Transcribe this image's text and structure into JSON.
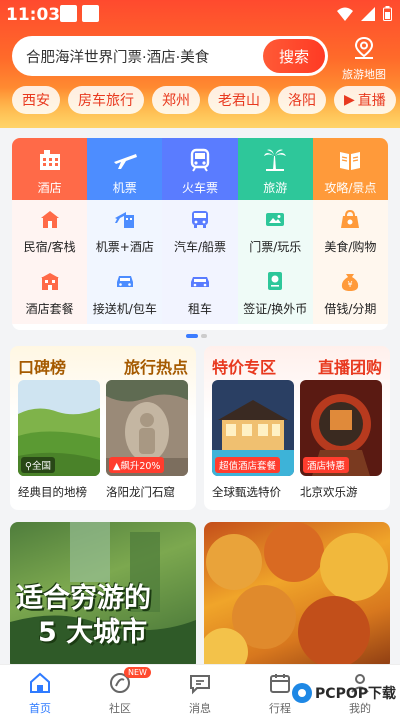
{
  "status_bar": {
    "time": "11:03"
  },
  "search": {
    "placeholder": "合肥海洋世界门票·酒店·美食",
    "button_label": "搜索"
  },
  "map_entry": {
    "label": "旅游地图"
  },
  "chips": [
    "西安",
    "房车旅行",
    "郑州",
    "老君山",
    "洛阳",
    "直播"
  ],
  "main_services": [
    {
      "label": "酒店",
      "icon": "hotel-icon",
      "color": "#ff6a48"
    },
    {
      "label": "机票",
      "icon": "plane-icon",
      "color": "#4d8dff"
    },
    {
      "label": "火车票",
      "icon": "train-icon",
      "color": "#5a7cff"
    },
    {
      "label": "旅游",
      "icon": "palm-icon",
      "color": "#2ec79a"
    },
    {
      "label": "攻略/景点",
      "icon": "book-icon",
      "color": "#ff9a3a"
    }
  ],
  "sub_services": [
    [
      {
        "label": "民宿/客栈",
        "icon": "house-icon"
      },
      {
        "label": "机票+酒店",
        "icon": "plane-hotel-icon"
      },
      {
        "label": "汽车/船票",
        "icon": "bus-icon"
      },
      {
        "label": "门票/玩乐",
        "icon": "ticket-icon"
      },
      {
        "label": "美食/购物",
        "icon": "food-bag-icon"
      }
    ],
    [
      {
        "label": "酒店套餐",
        "icon": "hotel-package-icon"
      },
      {
        "label": "接送机/包车",
        "icon": "car-icon"
      },
      {
        "label": "租车",
        "icon": "rental-car-icon"
      },
      {
        "label": "签证/换外币",
        "icon": "visa-icon"
      },
      {
        "label": "借钱/分期",
        "icon": "money-bag-icon"
      }
    ]
  ],
  "promo_left": {
    "title_a": "口碑榜",
    "title_b": "旅行热点",
    "items": [
      {
        "tag": "全国",
        "caption": "经典目的地榜"
      },
      {
        "tag": "飙升20%",
        "caption": "洛阳龙门石窟"
      }
    ]
  },
  "promo_right": {
    "title_a": "特价专区",
    "title_b": "直播团购",
    "items": [
      {
        "tag": "超值酒店套餐",
        "caption": "全球甄选特价"
      },
      {
        "tag": "酒店特惠",
        "caption": "北京欢乐游"
      }
    ]
  },
  "feed": {
    "left_title_line1": "适合穷游的",
    "left_title_line2": "5 大城市"
  },
  "tabs": [
    {
      "label": "首页",
      "icon": "home-icon"
    },
    {
      "label": "社区",
      "icon": "community-icon",
      "badge": "NEW"
    },
    {
      "label": "消息",
      "icon": "message-icon"
    },
    {
      "label": "行程",
      "icon": "calendar-icon"
    },
    {
      "label": "我的",
      "icon": "profile-icon"
    }
  ],
  "watermark": {
    "text": "PCPOP下载"
  }
}
